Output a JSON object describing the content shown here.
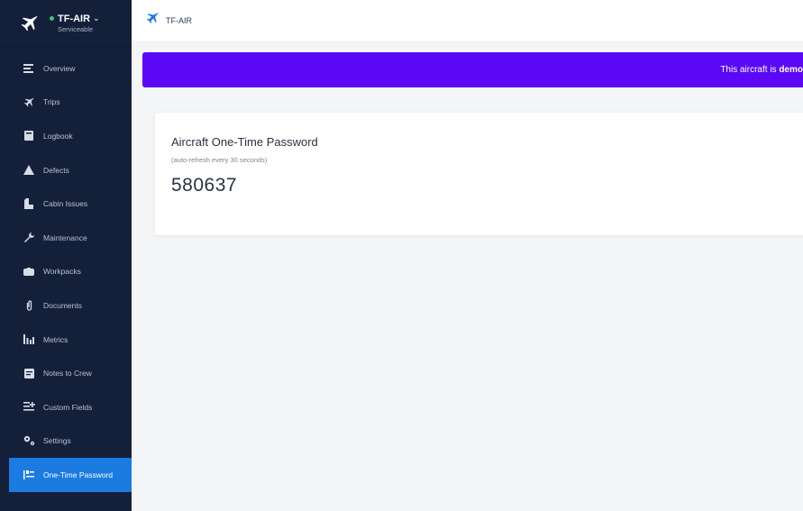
{
  "aircraft": {
    "registration": "TF-AIR",
    "status": "Serviceable",
    "status_color": "#37c47a"
  },
  "sidebar": {
    "items": [
      {
        "label": "Overview",
        "icon": "list-icon"
      },
      {
        "label": "Trips",
        "icon": "plane-icon"
      },
      {
        "label": "Logbook",
        "icon": "book-icon"
      },
      {
        "label": "Defects",
        "icon": "warning-icon"
      },
      {
        "label": "Cabin Issues",
        "icon": "seat-icon"
      },
      {
        "label": "Maintenance",
        "icon": "wrench-icon"
      },
      {
        "label": "Workpacks",
        "icon": "box-icon"
      },
      {
        "label": "Documents",
        "icon": "paperclip-icon"
      },
      {
        "label": "Metrics",
        "icon": "bar-chart-icon"
      },
      {
        "label": "Notes to Crew",
        "icon": "note-icon"
      },
      {
        "label": "Custom Fields",
        "icon": "add-list-icon"
      },
      {
        "label": "Settings",
        "icon": "gears-icon"
      },
      {
        "label": "One-Time Password",
        "icon": "key-icon",
        "active": true
      }
    ]
  },
  "topbar": {
    "breadcrumb": "TF-AIR"
  },
  "banner": {
    "text": "This aircraft is ",
    "emphasis": "demo",
    "color": "#5b08f7"
  },
  "otp": {
    "title": "Aircraft One-Time Password",
    "subtitle": "(auto-refresh every 30 seconds)",
    "code": "580637"
  },
  "colors": {
    "sidebar_bg": "#141f3a",
    "active": "#1b7be0",
    "accent_plane": "#1b7be0"
  }
}
